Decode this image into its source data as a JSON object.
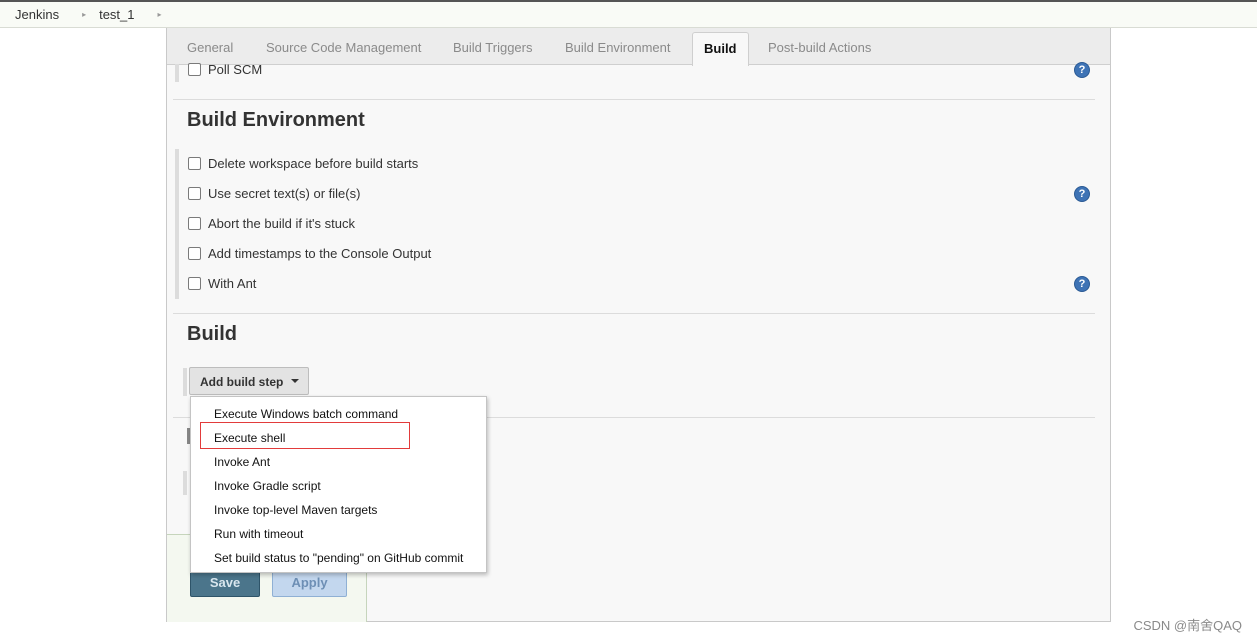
{
  "breadcrumb": {
    "items": [
      "Jenkins",
      "test_1"
    ]
  },
  "tabs": [
    "General",
    "Source Code Management",
    "Build Triggers",
    "Build Environment",
    "Build",
    "Post-build Actions"
  ],
  "active_tab": "Build",
  "triggers": {
    "poll_scm": "Poll SCM"
  },
  "build_environment": {
    "title": "Build Environment",
    "options": [
      "Delete workspace before build starts",
      "Use secret text(s) or file(s)",
      "Abort the build if it's stuck",
      "Add timestamps to the Console Output",
      "With Ant"
    ]
  },
  "build": {
    "title": "Build",
    "add_step_label": "Add build step"
  },
  "add_step_menu": {
    "items": [
      "Execute Windows batch command",
      "Execute shell",
      "Invoke Ant",
      "Invoke Gradle script",
      "Invoke top-level Maven targets",
      "Run with timeout",
      "Set build status to \"pending\" on GitHub commit"
    ],
    "highlighted": "Execute shell"
  },
  "actions": {
    "save": "Save",
    "apply": "Apply"
  },
  "help_glyph": "?",
  "watermark": "CSDN @南舍QAQ",
  "colors": {
    "help_icon": "#3e73b5",
    "highlight_border": "#e23b3b",
    "save_button": "#4b758b",
    "apply_button": "#c3d7ee"
  }
}
